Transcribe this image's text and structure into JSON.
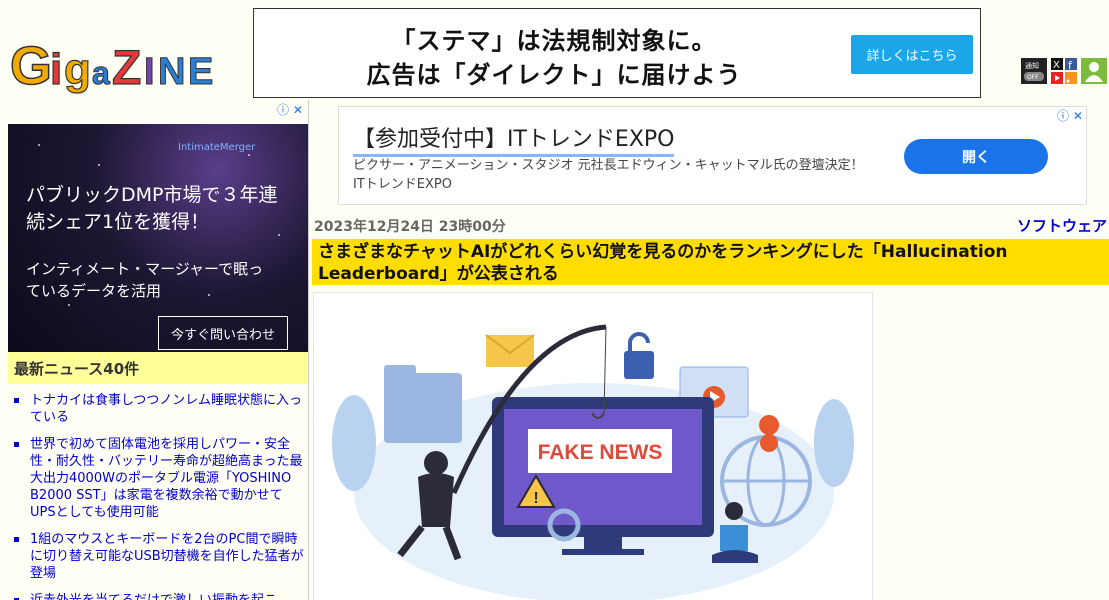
{
  "header": {
    "logo_text": "GIGAZINE",
    "banner": {
      "line1": "「ステマ」は法規制対象に。",
      "line2": "広告は「ダイレクト」に届けよう",
      "button": "詳しくはこちら"
    },
    "icons": [
      "notify-off-icon",
      "x-icon",
      "social-icon",
      "user-icon"
    ],
    "notify_label": "通知 OFF"
  },
  "sidebar": {
    "ad": {
      "brand": "IntimateMerger",
      "headline": "パブリックDMP市場で３年連続シェア1位を獲得！",
      "sub": "インティメート・マージャーで眠っているデータを活用",
      "button": "今すぐ問い合わせ"
    },
    "news_heading": "最新ニュース40件",
    "news": [
      "トナカイは食事しつつノンレム睡眠状態に入っている",
      "世界で初めて固体電池を採用しパワー・安全性・耐久性・バッテリー寿命が超絶高まった最大出力4000Wのポータブル電源「YOSHINO B2000 SST」は家電を複数余裕で動かせてUPSとしても使用可能",
      "1組のマウスとキーボードを2台のPC間で瞬時に切り替え可能なUSB切替機を自作した猛者が登場",
      "近赤外光を当てるだけで激しい振動を起こ"
    ]
  },
  "main": {
    "ad": {
      "title": "【参加受付中】ITトレンドEXPO",
      "desc": "ピクサー・アニメーション・スタジオ 元社長エドウィン・キャットマル氏の登壇決定！ ITトレンドEXPO",
      "button": "開く"
    },
    "date": "2023年12月24日 23時00分",
    "category": "ソフトウェア",
    "title": "さまざまなチャットAIがどれくらい幻覚を見るのかをランキングにした「Hallucination Leaderboard」が公表される",
    "hero_text": "FAKE NEWS"
  },
  "colors": {
    "title_bg": "#ffdd00",
    "news_head_bg": "#ffff99",
    "link": "#0000cc",
    "ad_button": "#1a73e8"
  }
}
